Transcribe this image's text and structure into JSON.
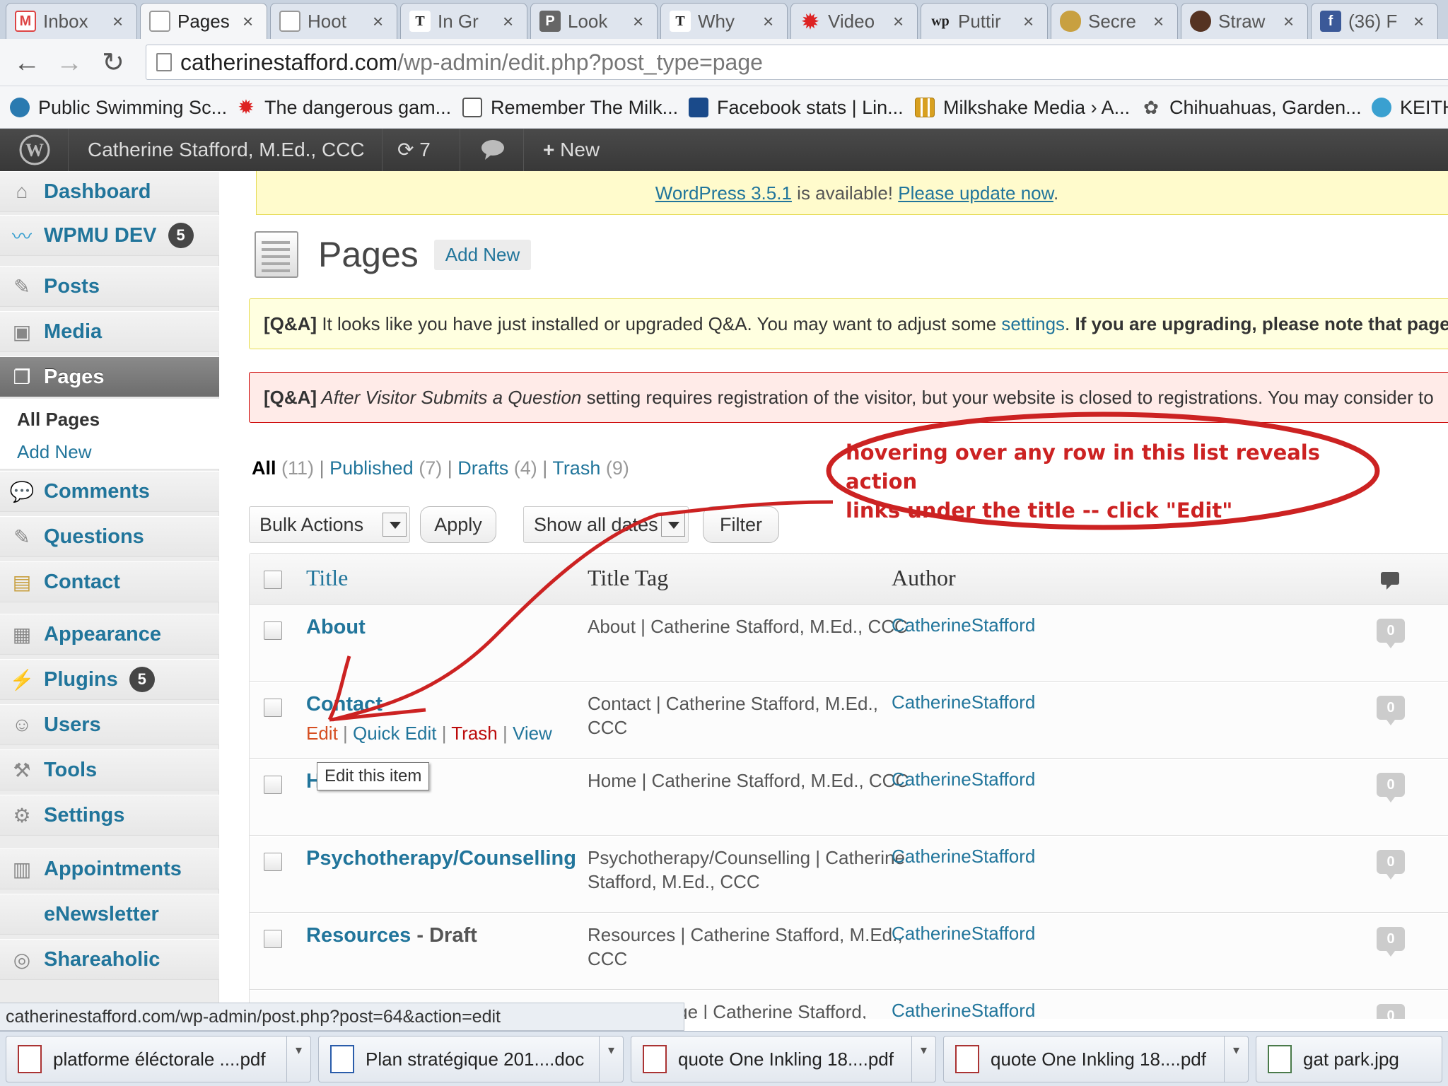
{
  "browser": {
    "tabs": [
      {
        "label": "Inbox",
        "icon": "gmail-icon",
        "color": "#d44"
      },
      {
        "label": "Pages",
        "icon": "page-icon",
        "color": "#999",
        "active": true
      },
      {
        "label": "Hoot",
        "icon": "page-icon",
        "color": "#999"
      },
      {
        "label": "In Gr",
        "icon": "nytimes-icon",
        "color": "#222"
      },
      {
        "label": "Look",
        "icon": "page-icon",
        "color": "#777"
      },
      {
        "label": "Why",
        "icon": "nytimes-icon",
        "color": "#222"
      },
      {
        "label": "Video",
        "icon": "maple-leaf-icon",
        "color": "#d22"
      },
      {
        "label": "Puttir",
        "icon": "washingtonpost-icon",
        "color": "#222"
      },
      {
        "label": "Secre",
        "icon": "cloud-icon",
        "color": "#c8a040"
      },
      {
        "label": "Straw",
        "icon": "person-icon",
        "color": "#553322"
      },
      {
        "label": "(36) F",
        "icon": "facebook-icon",
        "color": "#3b5998"
      }
    ],
    "tab_close_glyph": "×",
    "url_domain": "catherinestafford.com",
    "url_path": "/wp-admin/edit.php?post_type=page",
    "bookmarks": [
      {
        "label": "Public Swimming Sc...",
        "icon": "swimmer-icon",
        "color": "#2a7ab0"
      },
      {
        "label": "The dangerous gam...",
        "icon": "maple-leaf-icon",
        "color": "#d22"
      },
      {
        "label": "Remember The Milk...",
        "icon": "cow-icon",
        "color": "#555"
      },
      {
        "label": "Facebook stats | Lin...",
        "icon": "chart-icon",
        "color": "#1a4a8a"
      },
      {
        "label": "Milkshake Media › A...",
        "icon": "bars-icon",
        "color": "#d8a020"
      },
      {
        "label": "Chihuahuas, Garden...",
        "icon": "plant-icon",
        "color": "#555"
      },
      {
        "label": "KEITH",
        "icon": "globe-icon",
        "color": "#3aa0d0"
      }
    ]
  },
  "adminbar": {
    "site_name": "Catherine Stafford, M.Ed., CCC",
    "updates_count": "7",
    "new_label": "New"
  },
  "sidebar": {
    "items": [
      {
        "label": "Dashboard",
        "icon": "dashboard-icon"
      },
      {
        "label": "WPMU DEV",
        "icon": "wpmudev-icon",
        "badge": "5"
      },
      {
        "label": "Posts",
        "icon": "pushpin-icon"
      },
      {
        "label": "Media",
        "icon": "media-icon"
      },
      {
        "label": "Pages",
        "icon": "pages-icon",
        "current": true
      },
      {
        "label": "Comments",
        "icon": "comments-icon"
      },
      {
        "label": "Questions",
        "icon": "pushpin-icon"
      },
      {
        "label": "Contact",
        "icon": "contact-icon"
      },
      {
        "label": "Appearance",
        "icon": "appearance-icon"
      },
      {
        "label": "Plugins",
        "icon": "plugins-icon",
        "badge": "5"
      },
      {
        "label": "Users",
        "icon": "users-icon"
      },
      {
        "label": "Tools",
        "icon": "tools-icon"
      },
      {
        "label": "Settings",
        "icon": "settings-icon"
      },
      {
        "label": "Appointments",
        "icon": "appointments-icon"
      },
      {
        "label": "eNewsletter",
        "icon": ""
      },
      {
        "label": "Shareaholic",
        "icon": "shareaholic-icon"
      }
    ],
    "submenu": [
      "All Pages",
      "Add New"
    ]
  },
  "main": {
    "update_nag": {
      "link1": "WordPress 3.5.1",
      "middle": " is available! ",
      "link2": "Please update now",
      "end": "."
    },
    "title": "Pages",
    "add_new": "Add New",
    "notice1": {
      "tag": "[Q&A]",
      "text": " It looks like you have just installed or upgraded Q&A. You may want to adjust some ",
      "link": "settings",
      "after": ". ",
      "bold": "If you are upgrading, please note that page l"
    },
    "notice2": {
      "tag": "[Q&A]",
      "italic": " After Visitor Submits a Question",
      "text": " setting requires registration of the visitor, but your website is closed to registrations. You may consider to"
    },
    "filters": [
      {
        "label": "All",
        "count": "(11)",
        "current": true
      },
      {
        "label": "Published",
        "count": "(7)"
      },
      {
        "label": "Drafts",
        "count": "(4)"
      },
      {
        "label": "Trash",
        "count": "(9)"
      }
    ],
    "filter_sep": "|",
    "bulk_actions": "Bulk Actions",
    "apply": "Apply",
    "show_all_dates": "Show all dates",
    "filter": "Filter",
    "columns": {
      "title": "Title",
      "title_tag": "Title Tag",
      "author": "Author"
    },
    "rows": [
      {
        "title": "About",
        "tag": "About | Catherine Stafford, M.Ed., CCC",
        "author": "CatherineStafford",
        "comments": "0"
      },
      {
        "title": "Contact",
        "tag": "Contact | Catherine Stafford, M.Ed., CCC",
        "author": "CatherineStafford",
        "comments": "0",
        "actions": true
      },
      {
        "title": "Home",
        "tag": "Home | Catherine Stafford, M.Ed., CCC",
        "author": "CatherineStafford",
        "comments": "0"
      },
      {
        "title": "Psychotherapy/Counselling",
        "tag": "Psychotherapy/Counselling | Catherine Stafford, M.Ed., CCC",
        "author": "CatherineStafford",
        "comments": "0"
      },
      {
        "title": "Resources",
        "draft": " - Draft",
        "tag": "Resources | Catherine Stafford, M.Ed., CCC",
        "author": "CatherineStafford",
        "comments": "0"
      },
      {
        "title": "",
        "tag": "Sample Page | Catherine Stafford, M.Ed., CCC",
        "author": "CatherineStafford",
        "comments": "0"
      }
    ],
    "row_actions": {
      "edit": "Edit",
      "quick_edit": "Quick Edit",
      "trash": "Trash",
      "view": "View",
      "sep": " | "
    },
    "tooltip": "Edit this item"
  },
  "annotation": {
    "text_line1": "hovering over any row in this list reveals action",
    "text_line2": "links under the title -- click \"Edit\"",
    "color": "#cc2222"
  },
  "status_url": "catherinestafford.com/wp-admin/post.php?post=64&action=edit",
  "downloads": [
    {
      "label": "platforme éléctorale ....pdf",
      "icon": "pdf-icon"
    },
    {
      "label": "Plan stratégique 201....doc",
      "icon": "doc-icon"
    },
    {
      "label": "quote One Inkling 18....pdf",
      "icon": "pdf-icon"
    },
    {
      "label": "quote One Inkling 18....pdf",
      "icon": "pdf-icon"
    },
    {
      "label": "gat park.jpg",
      "icon": "image-icon"
    }
  ]
}
